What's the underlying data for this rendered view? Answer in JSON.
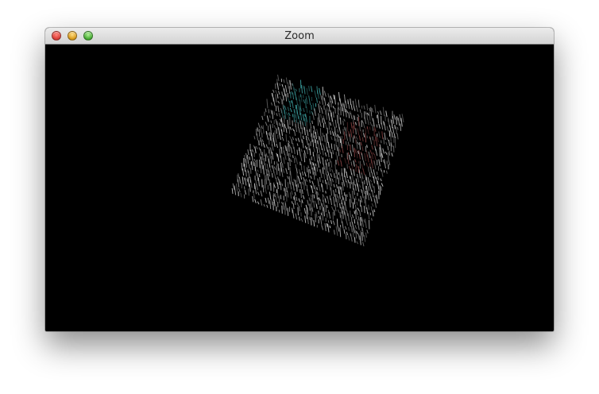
{
  "window": {
    "title": "Zoom"
  },
  "colors": {
    "canvas": "#000000",
    "points_primary": "#c8c8c8",
    "points_teal": "#3fa8a8",
    "points_red": "#8a4444"
  },
  "icons": {
    "close": "close-icon",
    "minimize": "minimize-icon",
    "zoom": "zoom-icon"
  }
}
